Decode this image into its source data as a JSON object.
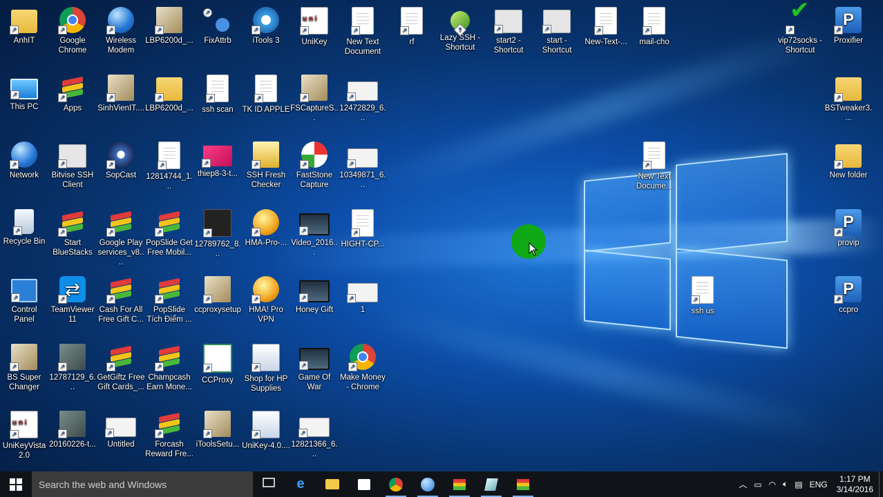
{
  "desktop": {
    "icons": [
      {
        "label": "AnhIT",
        "col": 0,
        "row": 0,
        "kind": "folder"
      },
      {
        "label": "Google\nChrome",
        "col": 1,
        "row": 0,
        "kind": "chrome"
      },
      {
        "label": "Wireless\nModem",
        "col": 2,
        "row": 0,
        "kind": "globe"
      },
      {
        "label": "LBP6200d_...",
        "col": 3,
        "row": 0,
        "kind": "box"
      },
      {
        "label": "FixAttrb",
        "col": 4,
        "row": 0,
        "kind": "dots"
      },
      {
        "label": "iTools 3",
        "col": 5,
        "row": 0,
        "kind": "itools"
      },
      {
        "label": "UniKey",
        "col": 6,
        "row": 0,
        "kind": "unikey"
      },
      {
        "label": "New Text\nDocument",
        "col": 7,
        "row": 0,
        "kind": "doc"
      },
      {
        "label": "rf",
        "col": 8,
        "row": 0,
        "kind": "doc"
      },
      {
        "label": "Lazy SSH -\nShortcut",
        "col": 9,
        "row": 0,
        "kind": "green"
      },
      {
        "label": "start2 -\nShortcut",
        "col": 10,
        "row": 0,
        "kind": "gear"
      },
      {
        "label": "start -\nShortcut",
        "col": 11,
        "row": 0,
        "kind": "gear"
      },
      {
        "label": "New-Text-...",
        "col": 12,
        "row": 0,
        "kind": "doc"
      },
      {
        "label": "mail-cho",
        "col": 13,
        "row": 0,
        "kind": "doc"
      },
      {
        "label": "vip72socks -\nShortcut",
        "col": 16,
        "row": 0,
        "kind": "check"
      },
      {
        "label": "Proxifier",
        "col": 17,
        "row": 0,
        "kind": "p"
      },
      {
        "label": "This PC",
        "col": 0,
        "row": 1,
        "kind": "pc"
      },
      {
        "label": "Apps",
        "col": 1,
        "row": 1,
        "kind": "bluestacks"
      },
      {
        "label": "SinhVienIT....",
        "col": 2,
        "row": 1,
        "kind": "box"
      },
      {
        "label": "LBP6200d_...",
        "col": 3,
        "row": 1,
        "kind": "folder"
      },
      {
        "label": "ssh scan",
        "col": 4,
        "row": 1,
        "kind": "doc"
      },
      {
        "label": "TK ID APPLE",
        "col": 5,
        "row": 1,
        "kind": "doc"
      },
      {
        "label": "FSCaptureS...",
        "col": 6,
        "row": 1,
        "kind": "box"
      },
      {
        "label": "12472829_6...",
        "col": 7,
        "row": 1,
        "kind": "thumb"
      },
      {
        "label": "BSTweaker3....",
        "col": 17,
        "row": 1,
        "kind": "folder"
      },
      {
        "label": "Network",
        "col": 0,
        "row": 2,
        "kind": "globe"
      },
      {
        "label": "Bitvise SSH\nClient",
        "col": 1,
        "row": 2,
        "kind": "gear"
      },
      {
        "label": "SopCast",
        "col": 2,
        "row": 2,
        "kind": "sopcast"
      },
      {
        "label": "12814744_1...",
        "col": 3,
        "row": 2,
        "kind": "doc"
      },
      {
        "label": "thiep8-3-t...",
        "col": 4,
        "row": 2,
        "kind": "pink"
      },
      {
        "label": "SSH Fresh\nChecker",
        "col": 5,
        "row": 2,
        "kind": "sshf"
      },
      {
        "label": "FastStone\nCapture",
        "col": 6,
        "row": 2,
        "kind": "faststone"
      },
      {
        "label": "10349871_6...",
        "col": 7,
        "row": 2,
        "kind": "thumb"
      },
      {
        "label": "New Text\nDocume...",
        "col": 13,
        "row": 2,
        "kind": "doc"
      },
      {
        "label": "New folder",
        "col": 17,
        "row": 2,
        "kind": "folder"
      },
      {
        "label": "Recycle Bin",
        "col": 0,
        "row": 3,
        "kind": "bin"
      },
      {
        "label": "Start\nBlueStacks",
        "col": 1,
        "row": 3,
        "kind": "bluestacks"
      },
      {
        "label": "Google Play\nservices_v8....",
        "col": 2,
        "row": 3,
        "kind": "bluestacks"
      },
      {
        "label": "PopSlide Get\nFree Mobil...",
        "col": 3,
        "row": 3,
        "kind": "bluestacks"
      },
      {
        "label": "12789762_8...",
        "col": 4,
        "row": 3,
        "kind": "dark"
      },
      {
        "label": "HMA-Pro-...",
        "col": 5,
        "row": 3,
        "kind": "hma"
      },
      {
        "label": "Video_2016...",
        "col": 6,
        "row": 3,
        "kind": "video"
      },
      {
        "label": "HIGHT-CP...",
        "col": 7,
        "row": 3,
        "kind": "doc"
      },
      {
        "label": "provip",
        "col": 17,
        "row": 3,
        "kind": "p"
      },
      {
        "label": "Control\nPanel",
        "col": 0,
        "row": 4,
        "kind": "cp"
      },
      {
        "label": "TeamViewer\n11",
        "col": 1,
        "row": 4,
        "kind": "teamviewer"
      },
      {
        "label": "Cash For All\nFree Gift C...",
        "col": 2,
        "row": 4,
        "kind": "bluestacks"
      },
      {
        "label": "PopSlide\nTích Điểm ...",
        "col": 3,
        "row": 4,
        "kind": "bluestacks"
      },
      {
        "label": "ccproxysetup",
        "col": 4,
        "row": 4,
        "kind": "box"
      },
      {
        "label": "HMA! Pro\nVPN",
        "col": 5,
        "row": 4,
        "kind": "hma"
      },
      {
        "label": "Honey Gift",
        "col": 6,
        "row": 4,
        "kind": "video"
      },
      {
        "label": "1",
        "col": 7,
        "row": 4,
        "kind": "thumb"
      },
      {
        "label": "ssh us",
        "col": 14,
        "row": 4,
        "kind": "doc"
      },
      {
        "label": "ccpro",
        "col": 17,
        "row": 4,
        "kind": "p"
      },
      {
        "label": "BS Super\nChanger",
        "col": 0,
        "row": 5,
        "kind": "box"
      },
      {
        "label": "12787129_6...",
        "col": 1,
        "row": 5,
        "kind": "photo"
      },
      {
        "label": "GetGiftz Free\nGift Cards_...",
        "col": 2,
        "row": 5,
        "kind": "bluestacks"
      },
      {
        "label": "Champcash\nEarn Mone...",
        "col": 3,
        "row": 5,
        "kind": "bluestacks"
      },
      {
        "label": "CCProxy",
        "col": 4,
        "row": 5,
        "kind": "ccproxy"
      },
      {
        "label": "Shop for HP\nSupplies",
        "col": 5,
        "row": 5,
        "kind": "hp"
      },
      {
        "label": "Game Of War",
        "col": 6,
        "row": 5,
        "kind": "video"
      },
      {
        "label": "Make Money\n- Chrome",
        "col": 7,
        "row": 5,
        "kind": "chrome"
      },
      {
        "label": "UniKeyVista\n2.0",
        "col": 0,
        "row": 6,
        "kind": "unikey"
      },
      {
        "label": "20160226-t...",
        "col": 1,
        "row": 6,
        "kind": "photo"
      },
      {
        "label": "Untitled",
        "col": 2,
        "row": 6,
        "kind": "thumb"
      },
      {
        "label": "Forcash\nReward Fre...",
        "col": 3,
        "row": 6,
        "kind": "bluestacks"
      },
      {
        "label": "iToolsSetu...",
        "col": 4,
        "row": 6,
        "kind": "box"
      },
      {
        "label": "UniKey-4.0....",
        "col": 5,
        "row": 6,
        "kind": "hp"
      },
      {
        "label": "12821366_6...",
        "col": 6,
        "row": 6,
        "kind": "thumb"
      }
    ]
  },
  "taskbar": {
    "search_placeholder": "Search the web and Windows",
    "apps": [
      {
        "name": "task-view",
        "icon": "task-view-icon",
        "active": false
      },
      {
        "name": "edge",
        "icon": "edge-icon",
        "active": false
      },
      {
        "name": "file-explorer",
        "icon": "folder-icon",
        "active": false
      },
      {
        "name": "store",
        "icon": "store-icon",
        "active": false
      },
      {
        "name": "chrome",
        "icon": "chrome-icon",
        "active": true
      },
      {
        "name": "network-app",
        "icon": "globe-icon",
        "active": true
      },
      {
        "name": "bluestacks",
        "icon": "bluestacks-icon",
        "active": true
      },
      {
        "name": "tool",
        "icon": "tool-icon",
        "active": true
      },
      {
        "name": "bluestacks-2",
        "icon": "bluestacks-icon",
        "active": true
      }
    ],
    "tray": {
      "language": "ENG",
      "time": "1:17 PM",
      "date": "3/14/2016"
    }
  }
}
